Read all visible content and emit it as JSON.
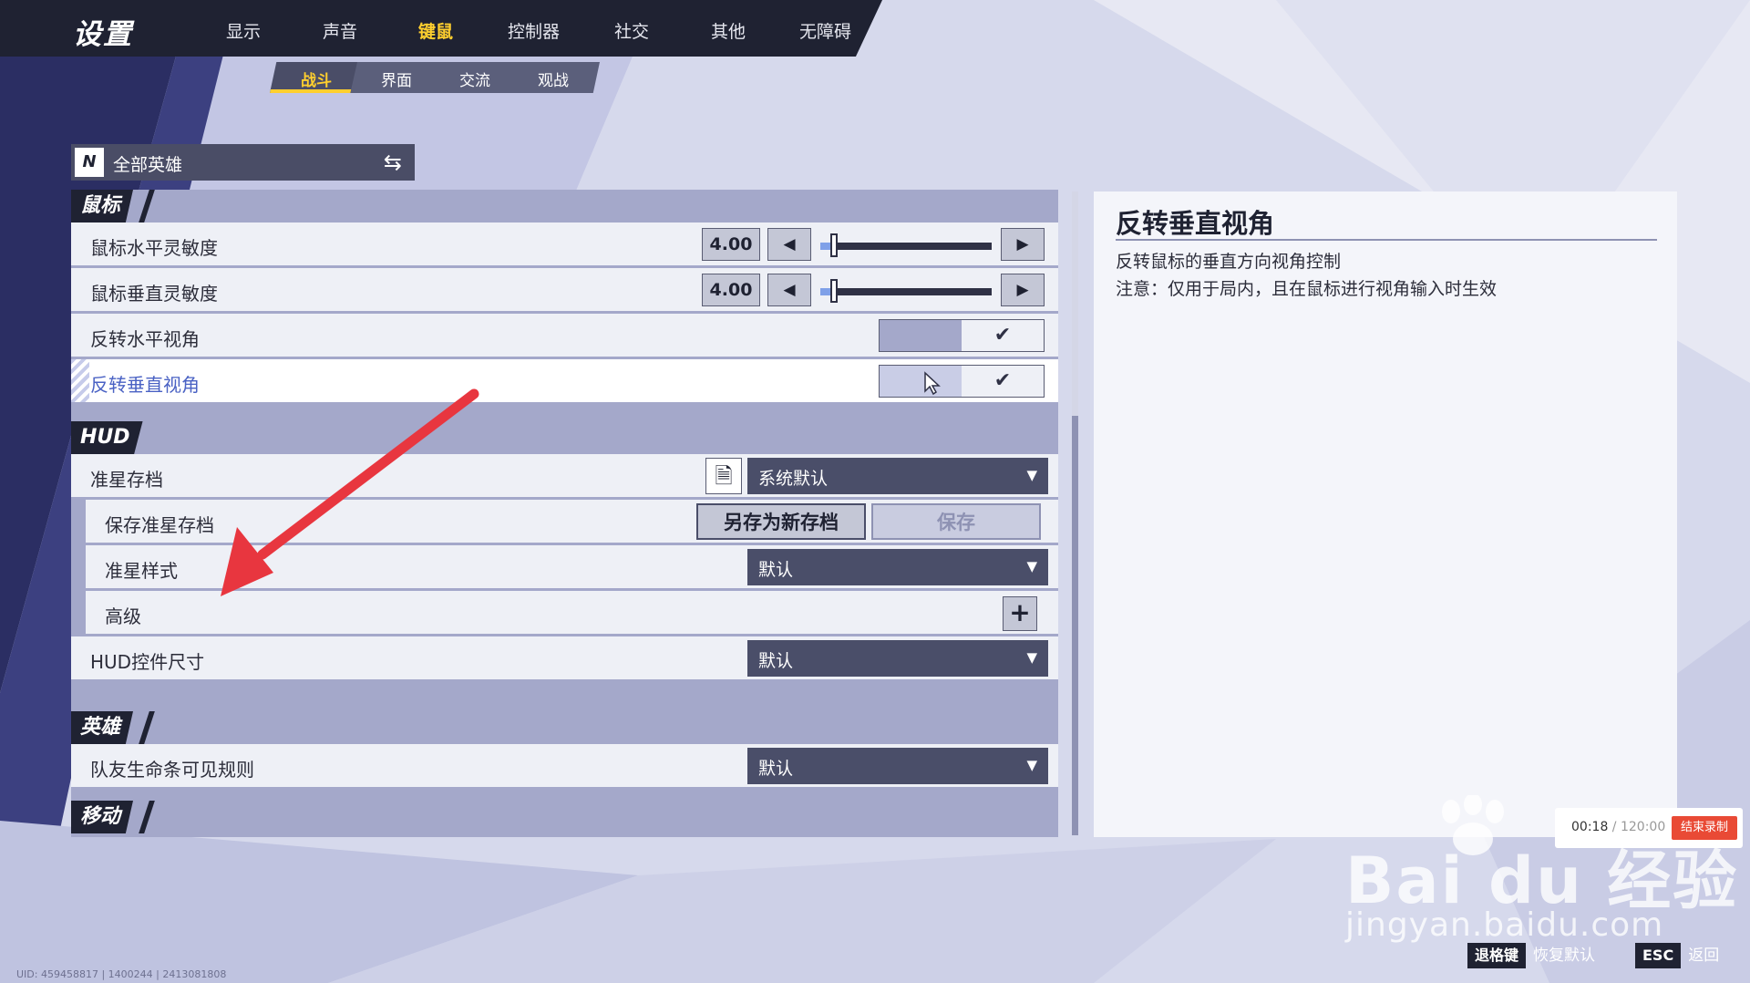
{
  "header": {
    "title": "设置",
    "tabs": [
      {
        "label": "显示",
        "active": false
      },
      {
        "label": "声音",
        "active": false
      },
      {
        "label": "键鼠",
        "active": true
      },
      {
        "label": "控制器",
        "active": false
      },
      {
        "label": "社交",
        "active": false
      },
      {
        "label": "其他",
        "active": false
      },
      {
        "label": "无障碍",
        "active": false
      }
    ],
    "subtabs": [
      {
        "label": "战斗",
        "active": true
      },
      {
        "label": "界面",
        "active": false
      },
      {
        "label": "交流",
        "active": false
      },
      {
        "label": "观战",
        "active": false
      }
    ]
  },
  "hero_selector": {
    "logo": "N",
    "label": "全部英雄",
    "icon": "swap-icon"
  },
  "sections": {
    "mouse": {
      "title": "鼠标",
      "horizontal_sensitivity": {
        "label": "鼠标水平灵敏度",
        "value": "4.00",
        "level": 0.08
      },
      "vertical_sensitivity": {
        "label": "鼠标垂直灵敏度",
        "value": "4.00",
        "level": 0.08
      },
      "invert_horizontal": {
        "label": "反转水平视角",
        "checked": true
      },
      "invert_vertical": {
        "label": "反转垂直视角",
        "checked": true
      }
    },
    "hud": {
      "title": "HUD",
      "crosshair_profile": {
        "label": "准星存档",
        "value": "系统默认"
      },
      "save_crosshair": {
        "label": "保存准星存档",
        "save_as_new": "另存为新存档",
        "save": "保存"
      },
      "crosshair_style": {
        "label": "准星样式",
        "value": "默认"
      },
      "advanced": {
        "label": "高级"
      },
      "hud_size": {
        "label": "HUD控件尺寸",
        "value": "默认"
      }
    },
    "hero": {
      "title": "英雄",
      "teammate_health": {
        "label": "队友生命条可见规则",
        "value": "默认"
      }
    },
    "movement": {
      "title": "移动"
    }
  },
  "description": {
    "title": "反转垂直视角",
    "line1": "反转鼠标的垂直方向视角控制",
    "line2": "注意：仅用于局内，且在鼠标进行视角输入时生效"
  },
  "recording": {
    "elapsed": "00:18",
    "total": " / 120:00",
    "stop": "结束录制"
  },
  "watermark": {
    "brand": "Bai du 经验",
    "url": "jingyan.baidu.com"
  },
  "bottom_hints": [
    {
      "key": "退格键",
      "label": "恢复默认"
    },
    {
      "key": "ESC",
      "label": "返回"
    }
  ],
  "uid": "UID: 459458817 | 1400244 | 2413081808",
  "colors": {
    "accent": "#ffcf2e",
    "panel": "#a4a8ca",
    "dark": "#1f2232",
    "annotation": "#e8363f",
    "highlight_label": "#4a62c4"
  }
}
